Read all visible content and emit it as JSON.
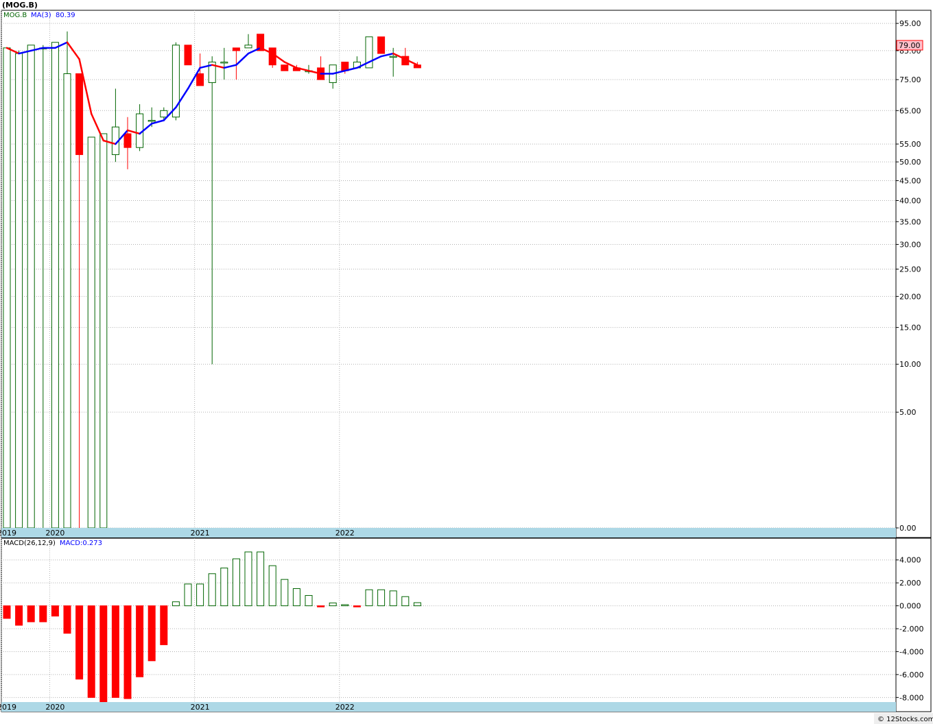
{
  "title": "(MOG.B)",
  "footer": "© 12Stocks.com",
  "colors": {
    "up": "#006400",
    "down": "#ff0000",
    "ma": "#0000ff",
    "axis_band": "#add8e6",
    "grid": "#b0b0b0",
    "price_label_bg": "#ffc0cb"
  },
  "chart_data": [
    {
      "type": "candlestick",
      "name": "price",
      "legend": {
        "symbol": "MOG.B",
        "ma_label": "MA(3)",
        "ma_value": "80.39"
      },
      "last_price_label": "79.00",
      "y_scale": "sqrt",
      "ylim": [
        0,
        100
      ],
      "y_ticks": [
        0,
        5,
        10,
        15,
        20,
        25,
        30,
        35,
        40,
        45,
        50,
        55,
        65,
        75,
        85,
        95
      ],
      "y_tick_labels": [
        "0.00",
        "5.00",
        "10.00",
        "15.00",
        "20.00",
        "25.00",
        "30.00",
        "35.00",
        "40.00",
        "45.00",
        "50.00",
        "55.00",
        "65.00",
        "75.00",
        "85.00",
        "95.00"
      ],
      "x_labels": [
        {
          "label": "2019",
          "index": 0
        },
        {
          "label": "2020",
          "index": 4
        },
        {
          "label": "2021",
          "index": 16
        },
        {
          "label": "2022",
          "index": 28
        }
      ],
      "candles": [
        {
          "o": 0,
          "h": 86,
          "l": 0,
          "c": 86
        },
        {
          "o": 0,
          "h": 85,
          "l": 0,
          "c": 84
        },
        {
          "o": 0,
          "h": 87,
          "l": 0,
          "c": 87
        },
        {
          "o": 86,
          "h": 87,
          "l": 0,
          "c": 86
        },
        {
          "o": 0,
          "h": 88,
          "l": 0,
          "c": 88
        },
        {
          "o": 0,
          "h": 92,
          "l": 0,
          "c": 77
        },
        {
          "o": 77,
          "h": 77,
          "l": 0,
          "c": 52
        },
        {
          "o": 0,
          "h": 57,
          "l": 0,
          "c": 57
        },
        {
          "o": 0,
          "h": 58,
          "l": 0,
          "c": 58
        },
        {
          "o": 52,
          "h": 72,
          "l": 50,
          "c": 60
        },
        {
          "o": 58,
          "h": 63,
          "l": 48,
          "c": 54
        },
        {
          "o": 54,
          "h": 67,
          "l": 53,
          "c": 64
        },
        {
          "o": 62,
          "h": 66,
          "l": 60,
          "c": 62
        },
        {
          "o": 63,
          "h": 66,
          "l": 62,
          "c": 65
        },
        {
          "o": 63,
          "h": 88,
          "l": 62,
          "c": 87
        },
        {
          "o": 87,
          "h": 87,
          "l": 80,
          "c": 80
        },
        {
          "o": 77,
          "h": 84,
          "l": 73,
          "c": 73
        },
        {
          "o": 74,
          "h": 83,
          "l": 10,
          "c": 81
        },
        {
          "o": 81,
          "h": 86,
          "l": 75,
          "c": 81
        },
        {
          "o": 86,
          "h": 86,
          "l": 75,
          "c": 85
        },
        {
          "o": 86,
          "h": 91,
          "l": 86,
          "c": 87
        },
        {
          "o": 91,
          "h": 91,
          "l": 85,
          "c": 85
        },
        {
          "o": 86,
          "h": 86,
          "l": 79,
          "c": 80
        },
        {
          "o": 80,
          "h": 80,
          "l": 78,
          "c": 78
        },
        {
          "o": 79,
          "h": 80,
          "l": 78,
          "c": 78
        },
        {
          "o": 78,
          "h": 80,
          "l": 77,
          "c": 78
        },
        {
          "o": 79,
          "h": 83,
          "l": 75,
          "c": 75
        },
        {
          "o": 74,
          "h": 80,
          "l": 72,
          "c": 80
        },
        {
          "o": 81,
          "h": 81,
          "l": 77,
          "c": 78
        },
        {
          "o": 79,
          "h": 83,
          "l": 79,
          "c": 81
        },
        {
          "o": 79,
          "h": 90,
          "l": 79,
          "c": 90
        },
        {
          "o": 90,
          "h": 90,
          "l": 84,
          "c": 84
        },
        {
          "o": 83,
          "h": 86,
          "l": 76,
          "c": 83
        },
        {
          "o": 83,
          "h": 86,
          "l": 80,
          "c": 80
        },
        {
          "o": 80,
          "h": 81,
          "l": 79,
          "c": 79
        }
      ],
      "ma": [
        86,
        84,
        85,
        86,
        86,
        88,
        82,
        64,
        56,
        55,
        59,
        58,
        61,
        62,
        66,
        72,
        79,
        80,
        79,
        80,
        84,
        86,
        84,
        81,
        79,
        78,
        77,
        77,
        78,
        79,
        81,
        83,
        84,
        82,
        80
      ]
    },
    {
      "type": "bar",
      "name": "macd",
      "legend": {
        "label": "MACD(26,12,9)",
        "value_label": "MACD:0.273"
      },
      "ylim": [
        -8.4,
        5.0
      ],
      "y_ticks": [
        4,
        2,
        0,
        -2,
        -4,
        -6,
        -8
      ],
      "y_tick_labels": [
        "4.000",
        "2.000",
        "0.000",
        "-2.000",
        "-4.000",
        "-6.000",
        "-8.000"
      ],
      "x_labels": [
        {
          "label": "2019",
          "index": 0
        },
        {
          "label": "2020",
          "index": 4
        },
        {
          "label": "2021",
          "index": 16
        },
        {
          "label": "2022",
          "index": 28
        }
      ],
      "values": [
        -1.1,
        -1.7,
        -1.4,
        -1.4,
        -0.9,
        -2.4,
        -6.4,
        -8.0,
        -8.4,
        -8.0,
        -8.1,
        -6.2,
        -4.8,
        -3.4,
        0.35,
        1.9,
        1.9,
        2.8,
        3.3,
        4.1,
        4.7,
        4.7,
        3.5,
        2.3,
        1.5,
        0.9,
        -0.1,
        0.25,
        0.1,
        -0.1,
        1.4,
        1.4,
        1.3,
        0.8,
        0.273
      ]
    }
  ]
}
